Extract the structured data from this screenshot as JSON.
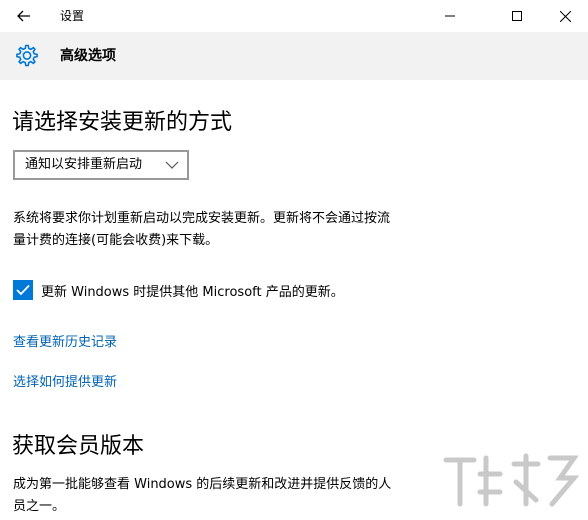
{
  "window": {
    "title": "设置"
  },
  "header": {
    "title": "高级选项"
  },
  "update_method": {
    "heading": "请选择安装更新的方式",
    "dropdown_selected": "通知以安排重新启动",
    "description_line1": "系统将要求你计划重新启动以完成安装更新。更新将不会通过按流",
    "description_line2": "量计费的连接(可能会收费)来下载。",
    "checkbox_label": "更新 Windows 时提供其他 Microsoft 产品的更新。",
    "checkbox_checked": true,
    "link_history": "查看更新历史记录",
    "link_delivery": "选择如何提供更新"
  },
  "insider": {
    "heading": "获取会员版本",
    "description_line1": "成为第一批能够查看 Windows 的后续更新和改进并提供反馈的人",
    "description_line2": "员之一。"
  },
  "colors": {
    "accent": "#0078d7",
    "link": "#0063b1",
    "header_bg": "#f2f2f2"
  },
  "icons": {
    "back": "back-arrow-icon",
    "settings": "gear-icon",
    "minimize": "minimize-icon",
    "maximize": "maximize-icon",
    "close": "close-icon",
    "dropdown": "chevron-down-icon",
    "check": "checkmark-icon"
  }
}
